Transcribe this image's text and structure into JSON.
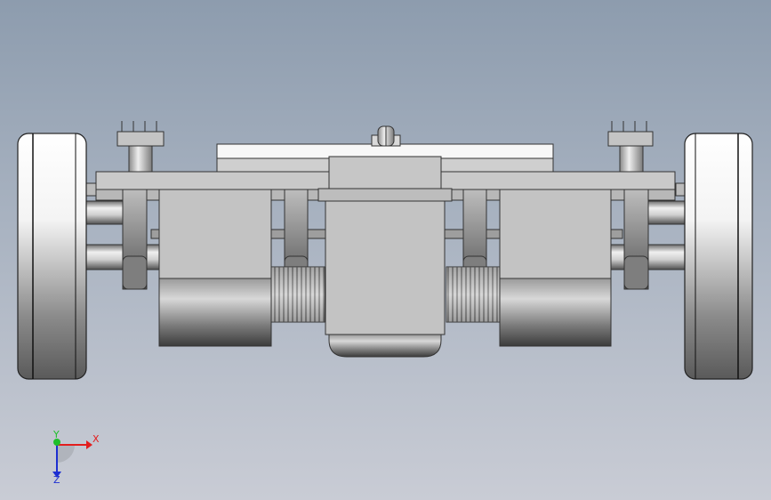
{
  "viewport": {
    "title": "",
    "view_orientation": "front",
    "background": [
      "#8d9cae",
      "#c9ccd5"
    ]
  },
  "model": {
    "name": "",
    "parts": [
      "left-wheel",
      "right-wheel",
      "left-hub-tube",
      "right-hub-tube",
      "left-post",
      "right-post",
      "main-chassis-plate",
      "top-plate",
      "center-caster-mount",
      "center-gearbox",
      "left-motor",
      "right-motor",
      "left-gear",
      "right-gear",
      "left-bracket",
      "right-bracket"
    ]
  },
  "triad": {
    "x_label": "X",
    "y_label": "Y",
    "z_label": "Z",
    "x_color": "#e21e1e",
    "y_color": "#1fbf2a",
    "z_color": "#1d2fd1"
  }
}
